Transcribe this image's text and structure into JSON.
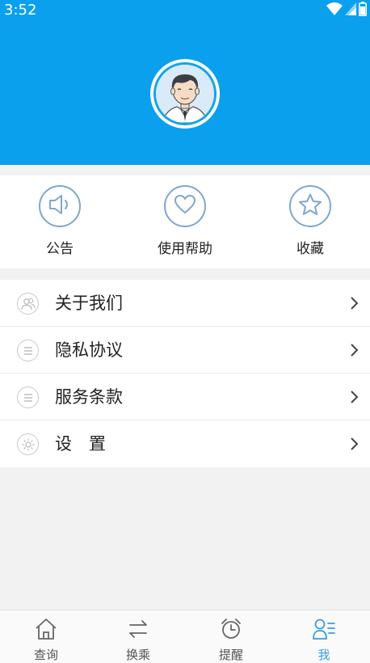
{
  "status_bar": {
    "time": "3:52"
  },
  "profile": {
    "avatar_icon": "user-avatar-icon"
  },
  "quick_actions": [
    {
      "label": "公告",
      "icon": "speaker-icon"
    },
    {
      "label": "使用帮助",
      "icon": "heart-icon"
    },
    {
      "label": "收藏",
      "icon": "star-icon"
    }
  ],
  "menu": [
    {
      "label": "关于我们",
      "icon": "users-icon"
    },
    {
      "label": "隐私协议",
      "icon": "list-icon"
    },
    {
      "label": "服务条款",
      "icon": "list-icon"
    },
    {
      "label": "设　置",
      "icon": "gear-icon"
    }
  ],
  "tabbar": [
    {
      "label": "查询",
      "icon": "home-icon",
      "active": false
    },
    {
      "label": "换乘",
      "icon": "transfer-icon",
      "active": false
    },
    {
      "label": "提醒",
      "icon": "alarm-clock-icon",
      "active": false
    },
    {
      "label": "我",
      "icon": "profile-icon",
      "active": true
    }
  ],
  "colors": {
    "header": "#0aa0ee",
    "accent": "#3a9be8",
    "icon_outline": "#7fa7cd"
  }
}
